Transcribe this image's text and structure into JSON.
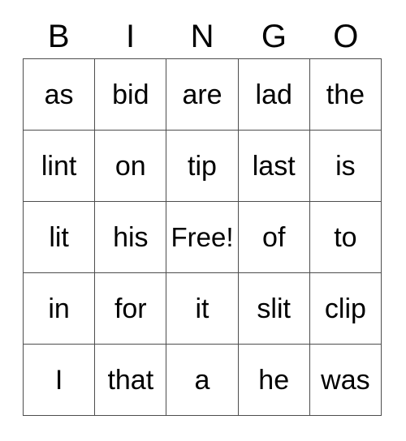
{
  "card": {
    "headers": [
      "B",
      "I",
      "N",
      "G",
      "O"
    ],
    "rows": [
      [
        "as",
        "bid",
        "are",
        "lad",
        "the"
      ],
      [
        "lint",
        "on",
        "tip",
        "last",
        "is"
      ],
      [
        "lit",
        "his",
        "Free!",
        "of",
        "to"
      ],
      [
        "in",
        "for",
        "it",
        "slit",
        "clip"
      ],
      [
        "I",
        "that",
        "a",
        "he",
        "was"
      ]
    ],
    "free_space": {
      "label": "Free!",
      "row": 2,
      "column": 2
    },
    "colors": {
      "background": "#ffffff",
      "text": "#000000",
      "grid_line": "#4d4d4d"
    }
  }
}
